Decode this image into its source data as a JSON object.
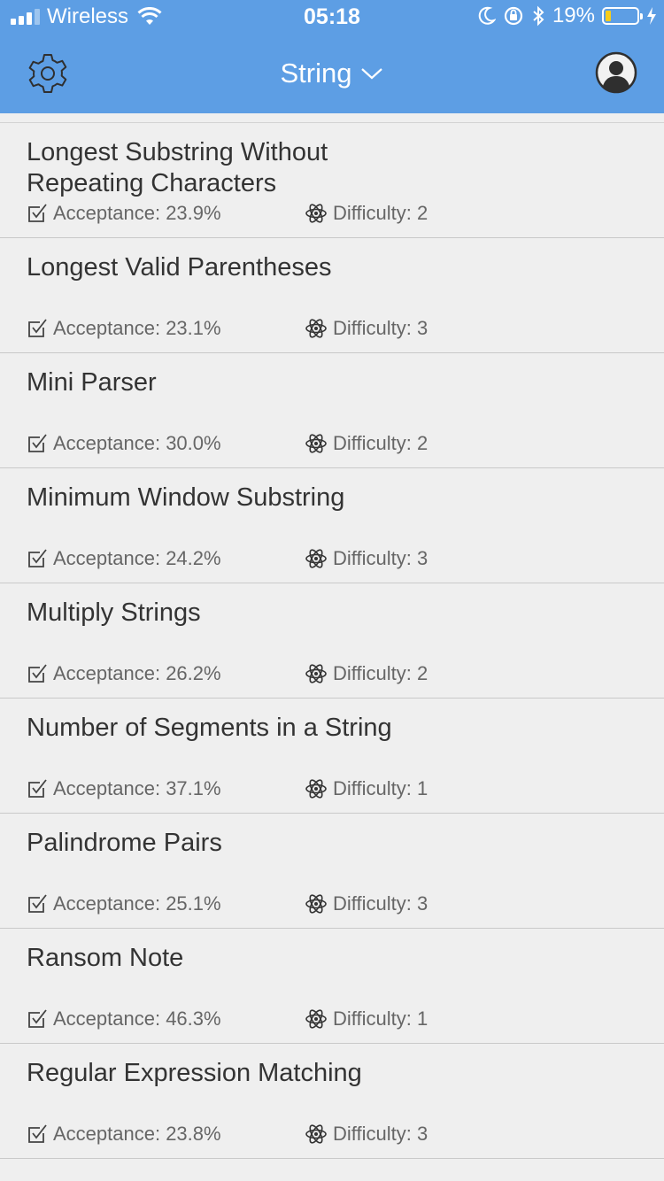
{
  "status_bar": {
    "carrier": "Wireless",
    "time": "05:18",
    "battery_percent": "19%",
    "battery_level": 0.19,
    "icons": [
      "signal-icon",
      "wifi-icon",
      "moon-icon",
      "orientation-lock-icon",
      "bluetooth-icon",
      "battery-icon",
      "charging-icon"
    ]
  },
  "nav": {
    "title": "String",
    "left_icon": "gear-icon",
    "title_icon": "chevron-down-icon",
    "right_icon": "user-avatar-icon"
  },
  "colors": {
    "header": "#5d9ee4",
    "background": "#efefef",
    "battery_fill": "#f6cd1c"
  },
  "problems": [
    {
      "title": "Longest Substring Without Repeating Characters",
      "acceptance": "Acceptance: 23.9%",
      "difficulty": "Difficulty: 2"
    },
    {
      "title": "Longest Valid Parentheses",
      "acceptance": "Acceptance: 23.1%",
      "difficulty": "Difficulty: 3"
    },
    {
      "title": "Mini Parser",
      "acceptance": "Acceptance: 30.0%",
      "difficulty": "Difficulty: 2"
    },
    {
      "title": "Minimum Window Substring",
      "acceptance": "Acceptance: 24.2%",
      "difficulty": "Difficulty: 3"
    },
    {
      "title": "Multiply Strings",
      "acceptance": "Acceptance: 26.2%",
      "difficulty": "Difficulty: 2"
    },
    {
      "title": "Number of Segments in a String",
      "acceptance": "Acceptance: 37.1%",
      "difficulty": "Difficulty: 1"
    },
    {
      "title": "Palindrome Pairs",
      "acceptance": "Acceptance: 25.1%",
      "difficulty": "Difficulty: 3"
    },
    {
      "title": "Ransom Note",
      "acceptance": "Acceptance: 46.3%",
      "difficulty": "Difficulty: 1"
    },
    {
      "title": "Regular Expression Matching",
      "acceptance": "Acceptance: 23.8%",
      "difficulty": "Difficulty: 3"
    }
  ]
}
